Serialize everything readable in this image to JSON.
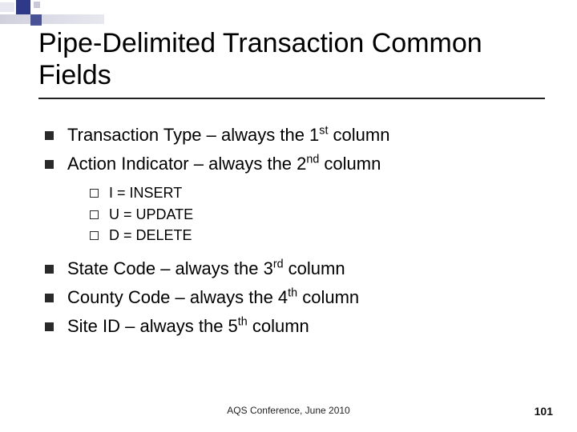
{
  "title": "Pipe-Delimited Transaction Common Fields",
  "bullets_a": [
    {
      "pre": "Transaction Type – always the 1",
      "ord": "st",
      "post": " column"
    },
    {
      "pre": "Action Indicator – always the 2",
      "ord": "nd",
      "post": " column"
    }
  ],
  "sub_bullets": [
    "I = INSERT",
    "U = UPDATE",
    "D = DELETE"
  ],
  "bullets_b": [
    {
      "pre": "State Code – always the 3",
      "ord": "rd",
      "post": " column"
    },
    {
      "pre": "County Code – always the 4",
      "ord": "th",
      "post": " column"
    },
    {
      "pre": "Site ID – always the 5",
      "ord": "th",
      "post": " column"
    }
  ],
  "footer": "AQS Conference, June 2010",
  "page": "101"
}
